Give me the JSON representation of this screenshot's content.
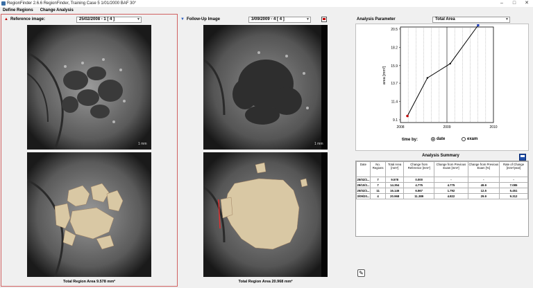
{
  "window": {
    "title": "RegionFinder 2.6.6 RegionFinder, Training Case 5 1/01/2000 BAF 30°",
    "minimize": "–",
    "maximize": "□",
    "close": "✕"
  },
  "menu": {
    "items": [
      "Define Regions",
      "Change Analysis"
    ]
  },
  "reference": {
    "label": "Reference image:",
    "selected": "25/02/2008 - 1 [ 4 ]",
    "scale": "1 mm",
    "caption": "Total Region Area 9.578 mm²"
  },
  "followup": {
    "label": "Follow-Up Image",
    "selected": "3/09/2009 - 4 [ 4 ]",
    "scale": "1 mm",
    "caption": "Total Region Area 20.968 mm²"
  },
  "analysis": {
    "label": "Analysis Parameter",
    "selected": "Total Area",
    "time_by_label": "time by:",
    "options": [
      "date",
      "exam"
    ],
    "selected_option": "date"
  },
  "chart_data": {
    "type": "line",
    "ylabel": "area [mm²]",
    "xlabel": "",
    "xticks": [
      "2008",
      "2009",
      "2010"
    ],
    "yticks": [
      "9.1",
      "11.4",
      "13.7",
      "15.9",
      "18.2",
      "20.5"
    ],
    "ylim": [
      9.1,
      20.5
    ],
    "xlim": [
      2008.0,
      2010.0
    ],
    "grid": true,
    "series": [
      {
        "x": [
          2008.15,
          2008.58,
          2009.07,
          2009.67
        ],
        "y": [
          9.578,
          14.354,
          16.146,
          20.968
        ]
      }
    ]
  },
  "summary": {
    "title": "Analysis Summary",
    "columns": [
      "Date",
      "No. Regions",
      "Total Area [mm²]",
      "Change from Reference [mm²]",
      "Change from Previous Exam [mm²]",
      "Change from Previous Exam [%]",
      "Rate of Change [mm²/year]"
    ],
    "rows": [
      [
        "25/02/2...",
        "7",
        "9.578",
        "0.000",
        "-",
        "-",
        "-"
      ],
      [
        "29/10/2...",
        "7",
        "14.354",
        "4.775",
        "4.775",
        "49.9",
        "7.085"
      ],
      [
        "25/02/2...",
        "11",
        "16.146",
        "6.567",
        "1.792",
        "12.5",
        "5.451"
      ],
      [
        "3/09/20...",
        "4",
        "20.968",
        "11.389",
        "4.822",
        "29.9",
        "9.312"
      ]
    ]
  },
  "colors": {
    "accent": "#c00000",
    "region": "#d9c8a4",
    "chart_line": "#000000"
  }
}
